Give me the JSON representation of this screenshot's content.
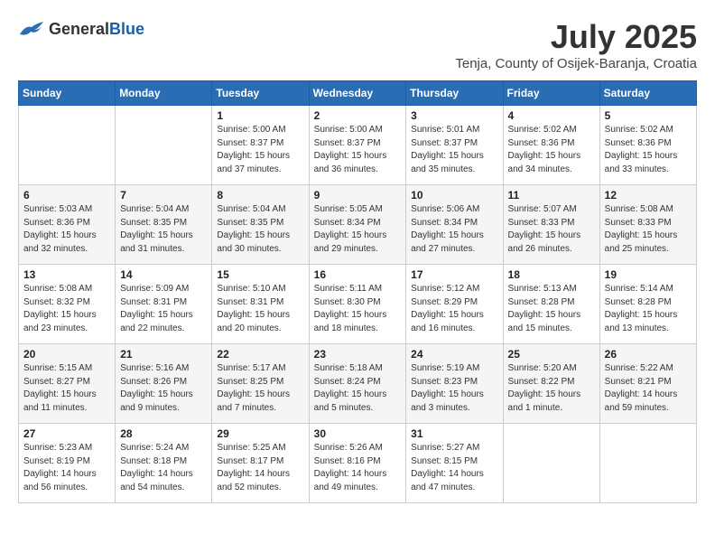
{
  "header": {
    "logo_general": "General",
    "logo_blue": "Blue",
    "month_year": "July 2025",
    "location": "Tenja, County of Osijek-Baranja, Croatia"
  },
  "days_of_week": [
    "Sunday",
    "Monday",
    "Tuesday",
    "Wednesday",
    "Thursday",
    "Friday",
    "Saturday"
  ],
  "weeks": [
    [
      {
        "day": "",
        "info": ""
      },
      {
        "day": "",
        "info": ""
      },
      {
        "day": "1",
        "info": "Sunrise: 5:00 AM\nSunset: 8:37 PM\nDaylight: 15 hours\nand 37 minutes."
      },
      {
        "day": "2",
        "info": "Sunrise: 5:00 AM\nSunset: 8:37 PM\nDaylight: 15 hours\nand 36 minutes."
      },
      {
        "day": "3",
        "info": "Sunrise: 5:01 AM\nSunset: 8:37 PM\nDaylight: 15 hours\nand 35 minutes."
      },
      {
        "day": "4",
        "info": "Sunrise: 5:02 AM\nSunset: 8:36 PM\nDaylight: 15 hours\nand 34 minutes."
      },
      {
        "day": "5",
        "info": "Sunrise: 5:02 AM\nSunset: 8:36 PM\nDaylight: 15 hours\nand 33 minutes."
      }
    ],
    [
      {
        "day": "6",
        "info": "Sunrise: 5:03 AM\nSunset: 8:36 PM\nDaylight: 15 hours\nand 32 minutes."
      },
      {
        "day": "7",
        "info": "Sunrise: 5:04 AM\nSunset: 8:35 PM\nDaylight: 15 hours\nand 31 minutes."
      },
      {
        "day": "8",
        "info": "Sunrise: 5:04 AM\nSunset: 8:35 PM\nDaylight: 15 hours\nand 30 minutes."
      },
      {
        "day": "9",
        "info": "Sunrise: 5:05 AM\nSunset: 8:34 PM\nDaylight: 15 hours\nand 29 minutes."
      },
      {
        "day": "10",
        "info": "Sunrise: 5:06 AM\nSunset: 8:34 PM\nDaylight: 15 hours\nand 27 minutes."
      },
      {
        "day": "11",
        "info": "Sunrise: 5:07 AM\nSunset: 8:33 PM\nDaylight: 15 hours\nand 26 minutes."
      },
      {
        "day": "12",
        "info": "Sunrise: 5:08 AM\nSunset: 8:33 PM\nDaylight: 15 hours\nand 25 minutes."
      }
    ],
    [
      {
        "day": "13",
        "info": "Sunrise: 5:08 AM\nSunset: 8:32 PM\nDaylight: 15 hours\nand 23 minutes."
      },
      {
        "day": "14",
        "info": "Sunrise: 5:09 AM\nSunset: 8:31 PM\nDaylight: 15 hours\nand 22 minutes."
      },
      {
        "day": "15",
        "info": "Sunrise: 5:10 AM\nSunset: 8:31 PM\nDaylight: 15 hours\nand 20 minutes."
      },
      {
        "day": "16",
        "info": "Sunrise: 5:11 AM\nSunset: 8:30 PM\nDaylight: 15 hours\nand 18 minutes."
      },
      {
        "day": "17",
        "info": "Sunrise: 5:12 AM\nSunset: 8:29 PM\nDaylight: 15 hours\nand 16 minutes."
      },
      {
        "day": "18",
        "info": "Sunrise: 5:13 AM\nSunset: 8:28 PM\nDaylight: 15 hours\nand 15 minutes."
      },
      {
        "day": "19",
        "info": "Sunrise: 5:14 AM\nSunset: 8:28 PM\nDaylight: 15 hours\nand 13 minutes."
      }
    ],
    [
      {
        "day": "20",
        "info": "Sunrise: 5:15 AM\nSunset: 8:27 PM\nDaylight: 15 hours\nand 11 minutes."
      },
      {
        "day": "21",
        "info": "Sunrise: 5:16 AM\nSunset: 8:26 PM\nDaylight: 15 hours\nand 9 minutes."
      },
      {
        "day": "22",
        "info": "Sunrise: 5:17 AM\nSunset: 8:25 PM\nDaylight: 15 hours\nand 7 minutes."
      },
      {
        "day": "23",
        "info": "Sunrise: 5:18 AM\nSunset: 8:24 PM\nDaylight: 15 hours\nand 5 minutes."
      },
      {
        "day": "24",
        "info": "Sunrise: 5:19 AM\nSunset: 8:23 PM\nDaylight: 15 hours\nand 3 minutes."
      },
      {
        "day": "25",
        "info": "Sunrise: 5:20 AM\nSunset: 8:22 PM\nDaylight: 15 hours\nand 1 minute."
      },
      {
        "day": "26",
        "info": "Sunrise: 5:22 AM\nSunset: 8:21 PM\nDaylight: 14 hours\nand 59 minutes."
      }
    ],
    [
      {
        "day": "27",
        "info": "Sunrise: 5:23 AM\nSunset: 8:19 PM\nDaylight: 14 hours\nand 56 minutes."
      },
      {
        "day": "28",
        "info": "Sunrise: 5:24 AM\nSunset: 8:18 PM\nDaylight: 14 hours\nand 54 minutes."
      },
      {
        "day": "29",
        "info": "Sunrise: 5:25 AM\nSunset: 8:17 PM\nDaylight: 14 hours\nand 52 minutes."
      },
      {
        "day": "30",
        "info": "Sunrise: 5:26 AM\nSunset: 8:16 PM\nDaylight: 14 hours\nand 49 minutes."
      },
      {
        "day": "31",
        "info": "Sunrise: 5:27 AM\nSunset: 8:15 PM\nDaylight: 14 hours\nand 47 minutes."
      },
      {
        "day": "",
        "info": ""
      },
      {
        "day": "",
        "info": ""
      }
    ]
  ]
}
